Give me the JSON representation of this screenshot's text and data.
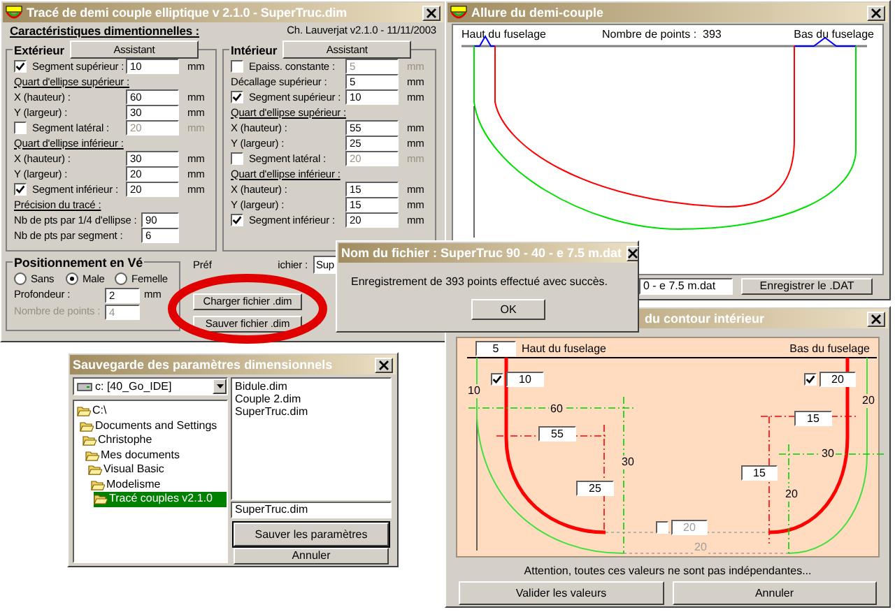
{
  "main_window": {
    "title": "Tracé de demi couple elliptique v 2.1.0 - SuperTruc.dim",
    "heading": "Caractéristiques dimentionnelles :",
    "author": "Ch. Lauverjat v2.1.0 - 11/11/2003",
    "groups": [
      {
        "title": "Extérieur",
        "assistant": "Assistant",
        "rows": [
          {
            "kind": "check",
            "label": "Segment supérieur :",
            "checked": true,
            "value": "10",
            "unit": "mm"
          },
          {
            "kind": "section",
            "label": "Quart d'ellipse supérieur :"
          },
          {
            "kind": "field",
            "label": "X (hauteur) :",
            "value": "60",
            "unit": "mm"
          },
          {
            "kind": "field",
            "label": "Y (largeur) :",
            "value": "30",
            "unit": "mm"
          },
          {
            "kind": "check",
            "label": "Segment latéral :",
            "checked": false,
            "value": "20",
            "unit": "mm"
          },
          {
            "kind": "section",
            "label": "Quart d'ellipse inférieur :"
          },
          {
            "kind": "field",
            "label": "X (hauteur) :",
            "value": "30",
            "unit": "mm"
          },
          {
            "kind": "field",
            "label": "Y (largeur) :",
            "value": "20",
            "unit": "mm"
          },
          {
            "kind": "check",
            "label": "Segment inférieur :",
            "checked": true,
            "value": "20",
            "unit": "mm"
          },
          {
            "kind": "section",
            "label": "Précision du tracé :"
          },
          {
            "kind": "count",
            "label": "Nb de pts par 1/4 d'ellipse :",
            "value": "90"
          },
          {
            "kind": "count",
            "label": "Nb de pts par segment :",
            "value": "6"
          }
        ]
      },
      {
        "title": "Intérieur",
        "assistant": "Assistant",
        "rows": [
          {
            "kind": "check",
            "label": "Epaiss. constante :",
            "checked": false,
            "value": "5",
            "unit": "mm"
          },
          {
            "kind": "field",
            "label": "Décallage supérieur :",
            "value": "5",
            "unit": "mm"
          },
          {
            "kind": "check",
            "label": "Segment supérieur :",
            "checked": true,
            "value": "10",
            "unit": "mm"
          },
          {
            "kind": "section",
            "label": "Quart d'ellipse supérieur :"
          },
          {
            "kind": "field",
            "label": "X (hauteur) :",
            "value": "55",
            "unit": "mm"
          },
          {
            "kind": "field",
            "label": "Y (largeur) :",
            "value": "25",
            "unit": "mm"
          },
          {
            "kind": "check",
            "label": "Segment latéral :",
            "checked": false,
            "value": "20",
            "unit": "mm"
          },
          {
            "kind": "section",
            "label": "Quart d'ellipse inférieur :"
          },
          {
            "kind": "field",
            "label": "X (hauteur) :",
            "value": "15",
            "unit": "mm"
          },
          {
            "kind": "field",
            "label": "Y (largeur) :",
            "value": "15",
            "unit": "mm"
          },
          {
            "kind": "check",
            "label": "Segment inférieur :",
            "checked": true,
            "value": "20",
            "unit": "mm"
          }
        ]
      }
    ],
    "positioning": {
      "title": "Positionnement en Vé",
      "options": [
        {
          "label": "Sans",
          "selected": false
        },
        {
          "label": "Male",
          "selected": true
        },
        {
          "label": "Femelle",
          "selected": false
        }
      ],
      "depth_label": "Profondeur :",
      "depth_value": "2",
      "depth_unit": "mm",
      "points_label": "Nombre de points :",
      "points_value": "4",
      "points_disabled": true
    },
    "prefix_label_start": "Préf",
    "prefix_label_end": "ichier :",
    "prefix_value": "Sup",
    "buttons": [
      "Charger fichier .dim",
      "Sauver fichier .dim"
    ]
  },
  "preview_window": {
    "title": "Allure du demi-couple",
    "top_left": "Haut du fuselage",
    "points_label": "Nombre de points :",
    "points_value": "393",
    "top_right": "Bas du fuselage",
    "file_value": "0 - e 7.5 m.dat",
    "save_button": "Enregistrer le .DAT"
  },
  "save_dialog": {
    "title": "Sauvegarde des paramètres dimensionnels",
    "drive": "c: [40_Go_IDE]",
    "tree": [
      {
        "label": "C:\\",
        "selected": false,
        "children": [
          {
            "label": "Documents and Settings",
            "selected": false,
            "children": [
              {
                "label": "Christophe",
                "selected": false,
                "children": [
                  {
                    "label": "Mes documents",
                    "selected": false,
                    "children": [
                      {
                        "label": "Visual Basic",
                        "selected": false,
                        "children": [
                          {
                            "label": "Modelisme",
                            "selected": false,
                            "children": [
                              {
                                "label": "Tracé couples v2.1.0",
                                "selected": true
                              }
                            ]
                          }
                        ]
                      }
                    ]
                  }
                ]
              }
            ]
          }
        ]
      }
    ],
    "files": [
      {
        "label": "Bidule.dim",
        "selected": false
      },
      {
        "label": "Couple 2.dim",
        "selected": false
      },
      {
        "label": "SuperTruc.dim",
        "selected": false
      }
    ],
    "file_name": "SuperTruc.dim",
    "buttons": [
      "Sauver les paramètres",
      "Annuler"
    ]
  },
  "contour_window": {
    "title": "du contour intérieur",
    "top_left": "Haut du fuselage",
    "top_right": "Bas du fuselage",
    "fields": [
      {
        "kind": "field",
        "value": "5"
      },
      {
        "kind": "check",
        "checked": true,
        "value": "10"
      },
      {
        "kind": "check",
        "checked": true,
        "value": "20"
      },
      {
        "kind": "field",
        "value": "15"
      },
      {
        "kind": "field",
        "value": "55"
      },
      {
        "kind": "field",
        "value": "15"
      },
      {
        "kind": "field",
        "value": "25"
      },
      {
        "kind": "check",
        "checked": false,
        "value": "20"
      }
    ],
    "dimension_labels": [
      {
        "text": "10",
        "disabled": false
      },
      {
        "text": "20",
        "disabled": false
      },
      {
        "text": "60",
        "disabled": false
      },
      {
        "text": "30",
        "disabled": false
      },
      {
        "text": "30",
        "disabled": false
      },
      {
        "text": "20",
        "disabled": false
      },
      {
        "text": "20",
        "disabled": true
      }
    ],
    "warning": "Attention, toutes ces valeurs ne sont pas indépendantes...",
    "buttons": [
      "Valider les valeurs",
      "Annuler"
    ]
  },
  "message_dialog": {
    "title": "Nom du fichier : SuperTruc 90 - 40 - e 7.5 m.dat",
    "message": "Enregistrement de 393 points effectué avec succès.",
    "ok": "OK"
  }
}
